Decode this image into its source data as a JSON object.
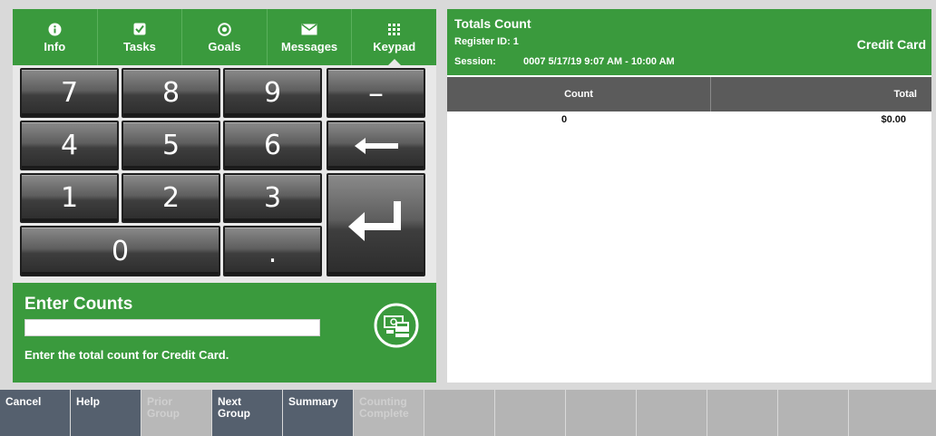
{
  "tabs": [
    {
      "label": "Info",
      "icon": "info-icon"
    },
    {
      "label": "Tasks",
      "icon": "checkbox-icon"
    },
    {
      "label": "Goals",
      "icon": "target-icon"
    },
    {
      "label": "Messages",
      "icon": "envelope-icon"
    },
    {
      "label": "Keypad",
      "icon": "keypad-icon",
      "active": true
    }
  ],
  "keypad": {
    "keys": [
      "7",
      "8",
      "9",
      "–",
      "4",
      "5",
      "6",
      "←",
      "1",
      "2",
      "3",
      "↵",
      "0",
      "."
    ],
    "backspace_icon": "backspace-arrow-icon",
    "enter_icon": "enter-arrow-icon"
  },
  "enter_counts": {
    "title": "Enter Counts",
    "input_value": "",
    "message": "Enter the total count for Credit Card.",
    "action_icon": "cash-register-icon"
  },
  "totals": {
    "title": "Totals Count",
    "register": "Register ID: 1",
    "session_label": "Session:",
    "session_value": "0007  5/17/19 9:07 AM - 10:00 AM",
    "tender": "Credit Card",
    "columns": [
      "Count",
      "Total"
    ],
    "rows": [
      {
        "count": "0",
        "total": "$0.00"
      }
    ]
  },
  "bottom_bar": [
    {
      "label": "Cancel",
      "enabled": true
    },
    {
      "label": "Help",
      "enabled": true
    },
    {
      "label": "Prior\nGroup",
      "enabled": false
    },
    {
      "label": "Next\nGroup",
      "enabled": true
    },
    {
      "label": "Summary",
      "enabled": true
    },
    {
      "label": "Counting\nComplete",
      "enabled": false
    },
    {
      "label": "",
      "enabled": false
    },
    {
      "label": "",
      "enabled": false
    },
    {
      "label": "",
      "enabled": false
    },
    {
      "label": "",
      "enabled": false
    },
    {
      "label": "",
      "enabled": false
    },
    {
      "label": "",
      "enabled": false
    },
    {
      "label": "",
      "enabled": false
    }
  ],
  "colors": {
    "brand_green": "#3a9a3d",
    "header_gray": "#5b5b5b",
    "button_enabled": "#55606e",
    "button_disabled": "#b8b8b8"
  }
}
